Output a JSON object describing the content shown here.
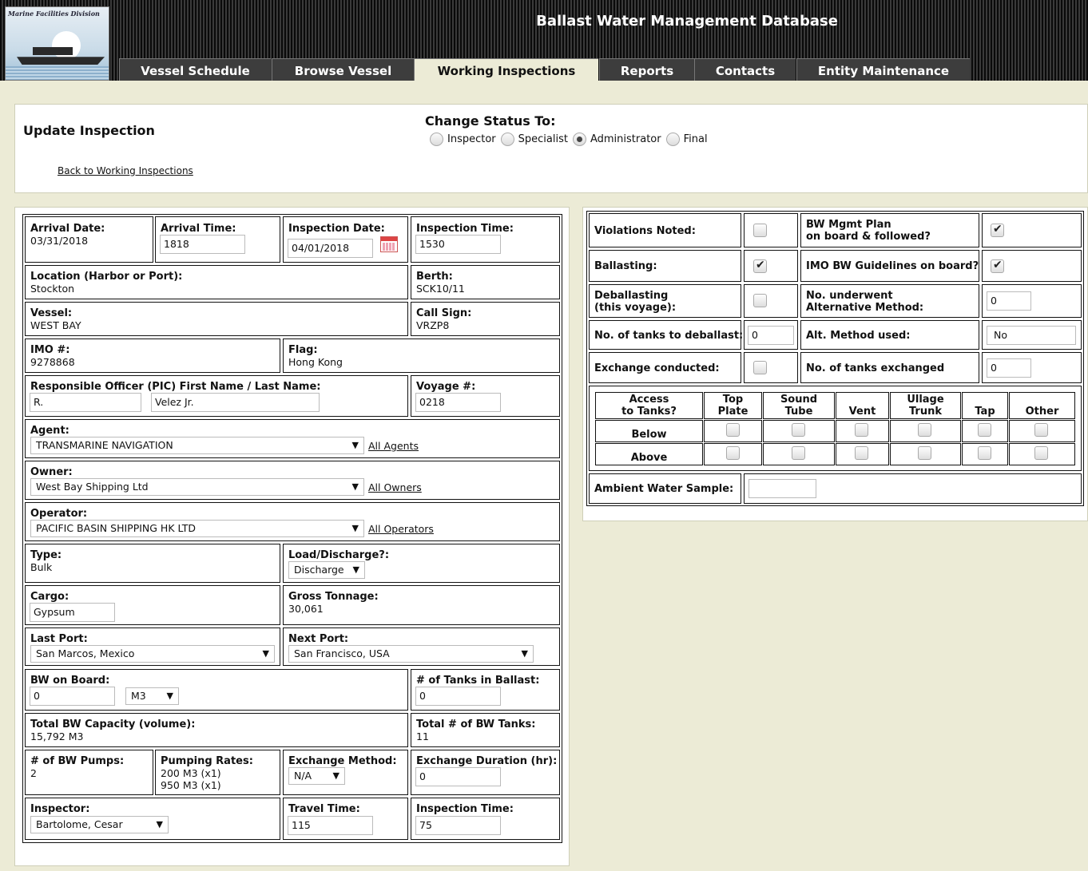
{
  "header": {
    "logo_text": "Marine Facilities Division",
    "title": "Ballast Water Management Database",
    "tabs": [
      "Vessel Schedule",
      "Browse Vessel",
      "Working Inspections",
      "Reports",
      "Contacts",
      "Entity Maintenance"
    ],
    "active_tab": "Working Inspections"
  },
  "update": {
    "title": "Update Inspection",
    "back_link": "Back to Working Inspections",
    "status_title": "Change Status To:",
    "status_options": [
      "Inspector",
      "Specialist",
      "Administrator",
      "Final"
    ],
    "selected_status": "Administrator"
  },
  "form": {
    "arrival_date_label": "Arrival Date:",
    "arrival_date": "03/31/2018",
    "arrival_time_label": "Arrival Time:",
    "arrival_time": "1818",
    "inspection_date_label": "Inspection Date:",
    "inspection_date": "04/01/2018",
    "inspection_time_label": "Inspection Time:",
    "inspection_time": "1530",
    "location_label": "Location (Harbor or Port):",
    "location": "Stockton",
    "berth_label": "Berth:",
    "berth": "SCK10/11",
    "vessel_label": "Vessel:",
    "vessel": "WEST BAY",
    "call_sign_label": "Call Sign:",
    "call_sign": "VRZP8",
    "imo_label": "IMO #:",
    "imo": "9278868",
    "flag_label": "Flag:",
    "flag": "Hong Kong",
    "pic_label": "Responsible Officer (PIC) First Name / Last Name:",
    "pic_first": "R.",
    "pic_last": "Velez Jr.",
    "voyage_label": "Voyage #:",
    "voyage": "0218",
    "agent_label": "Agent:",
    "agent": "TRANSMARINE NAVIGATION",
    "all_agents": "All Agents",
    "owner_label": "Owner:",
    "owner": "West Bay Shipping Ltd",
    "all_owners": "All Owners",
    "operator_label": "Operator:",
    "operator": "PACIFIC BASIN SHIPPING HK LTD",
    "all_operators": "All Operators",
    "type_label": "Type:",
    "type": "Bulk",
    "load_label": "Load/Discharge?:",
    "load": "Discharge",
    "cargo_label": "Cargo:",
    "cargo": "Gypsum",
    "gross_label": "Gross Tonnage:",
    "gross": "30,061",
    "last_port_label": "Last Port:",
    "last_port": "San Marcos, Mexico",
    "next_port_label": "Next Port:",
    "next_port": "San Francisco, USA",
    "bw_onboard_label": "BW on Board:",
    "bw_onboard": "0",
    "bw_unit": "M3",
    "tanks_ballast_label": "# of Tanks in Ballast:",
    "tanks_ballast": "0",
    "total_cap_label": "Total BW Capacity (volume):",
    "total_cap": "15,792 M3",
    "total_tanks_label": "Total # of BW Tanks:",
    "total_tanks": "11",
    "pumps_label": "# of BW Pumps:",
    "pumps": "2",
    "rates_label": "Pumping Rates:",
    "rate1": "200 M3 (x1)",
    "rate2": "950 M3 (x1)",
    "exch_method_label": "Exchange Method:",
    "exch_method": "N/A",
    "exch_dur_label": "Exchange Duration (hr):",
    "exch_dur": "0",
    "inspector_label": "Inspector:",
    "inspector": "Bartolome, Cesar",
    "travel_label": "Travel Time:",
    "travel": "115",
    "insp_time2_label": "Inspection Time:",
    "insp_time2": "75"
  },
  "right": {
    "violations_label": "Violations Noted:",
    "violations": false,
    "bwplan_label1": "BW Mgmt Plan",
    "bwplan_label2": "on board & followed?",
    "bwplan": true,
    "ballasting_label": "Ballasting:",
    "ballasting": true,
    "imo_guidelines_label": "IMO BW Guidelines on board?",
    "imo_guidelines": true,
    "deballast_label1": "Deballasting",
    "deballast_label2": "(this voyage):",
    "deballast": false,
    "alt_label1": "No. underwent",
    "alt_label2": "Alternative Method:",
    "alt_count": "0",
    "tanks_deballast_label": "No. of tanks to deballast:",
    "tanks_deballast": "0",
    "alt_method_label": "Alt. Method used:",
    "alt_method": "No",
    "exchange_label": "Exchange conducted:",
    "exchange": false,
    "tanks_exch_label": "No. of tanks exchanged",
    "tanks_exch": "0",
    "access_header1": "Access",
    "access_header2": "to Tanks?",
    "access_cols": [
      [
        "Top",
        "Plate"
      ],
      [
        "Sound",
        "Tube"
      ],
      [
        "",
        "Vent"
      ],
      [
        "Ullage",
        "Trunk"
      ],
      [
        "",
        "Tap"
      ],
      [
        "",
        "Other"
      ]
    ],
    "access_rows": [
      "Below",
      "Above"
    ],
    "ambient_label": "Ambient Water Sample:",
    "ambient": ""
  }
}
